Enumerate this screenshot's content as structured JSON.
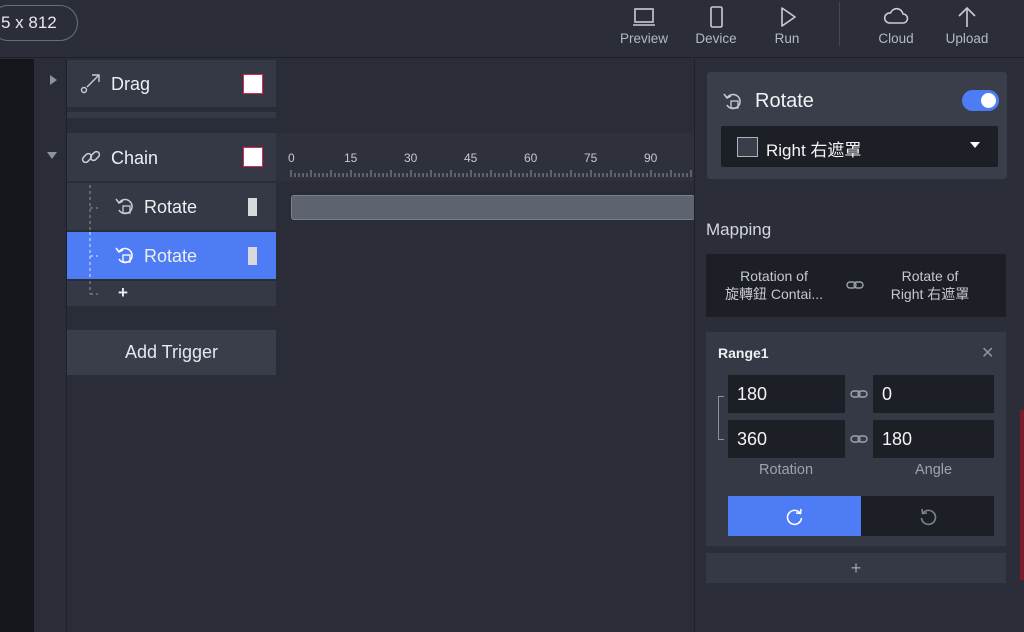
{
  "topbar": {
    "size_label": "5 x 812",
    "buttons": [
      {
        "label": "Preview",
        "icon": "laptop-icon"
      },
      {
        "label": "Device",
        "icon": "phone-icon"
      },
      {
        "label": "Run",
        "icon": "play-icon"
      },
      {
        "label": "Cloud",
        "icon": "cloud-icon"
      },
      {
        "label": "Upload",
        "icon": "upload-arrow-icon"
      }
    ]
  },
  "layers": {
    "drag_label": "Drag",
    "chain_label": "Chain",
    "rotate_1_label": "Rotate",
    "rotate_2_label": "Rotate",
    "add_symbol": "+",
    "add_trigger_label": "Add Trigger"
  },
  "timeline": {
    "ticks": [
      "0",
      "15",
      "30",
      "45",
      "60",
      "75",
      "90"
    ]
  },
  "panel": {
    "title": "Rotate",
    "enabled": true,
    "target_select": "Right 右遮罩",
    "mapping_title": "Mapping",
    "mapping_from_line1": "Rotation of",
    "mapping_from_line2": "旋轉鈕 Contai...",
    "mapping_to_line1": "Rotate of",
    "mapping_to_line2": "Right 右遮罩",
    "range": {
      "title": "Range1",
      "close_symbol": "✕",
      "rotation_start": "180",
      "angle_start": "0",
      "rotation_end": "360",
      "angle_end": "180",
      "rotation_label": "Rotation",
      "angle_label": "Angle"
    },
    "add_range_symbol": "+"
  },
  "colors": {
    "accent": "#4d7cf5",
    "selected_row": "#4d7cf5",
    "swatch_border": "#e0264f"
  }
}
